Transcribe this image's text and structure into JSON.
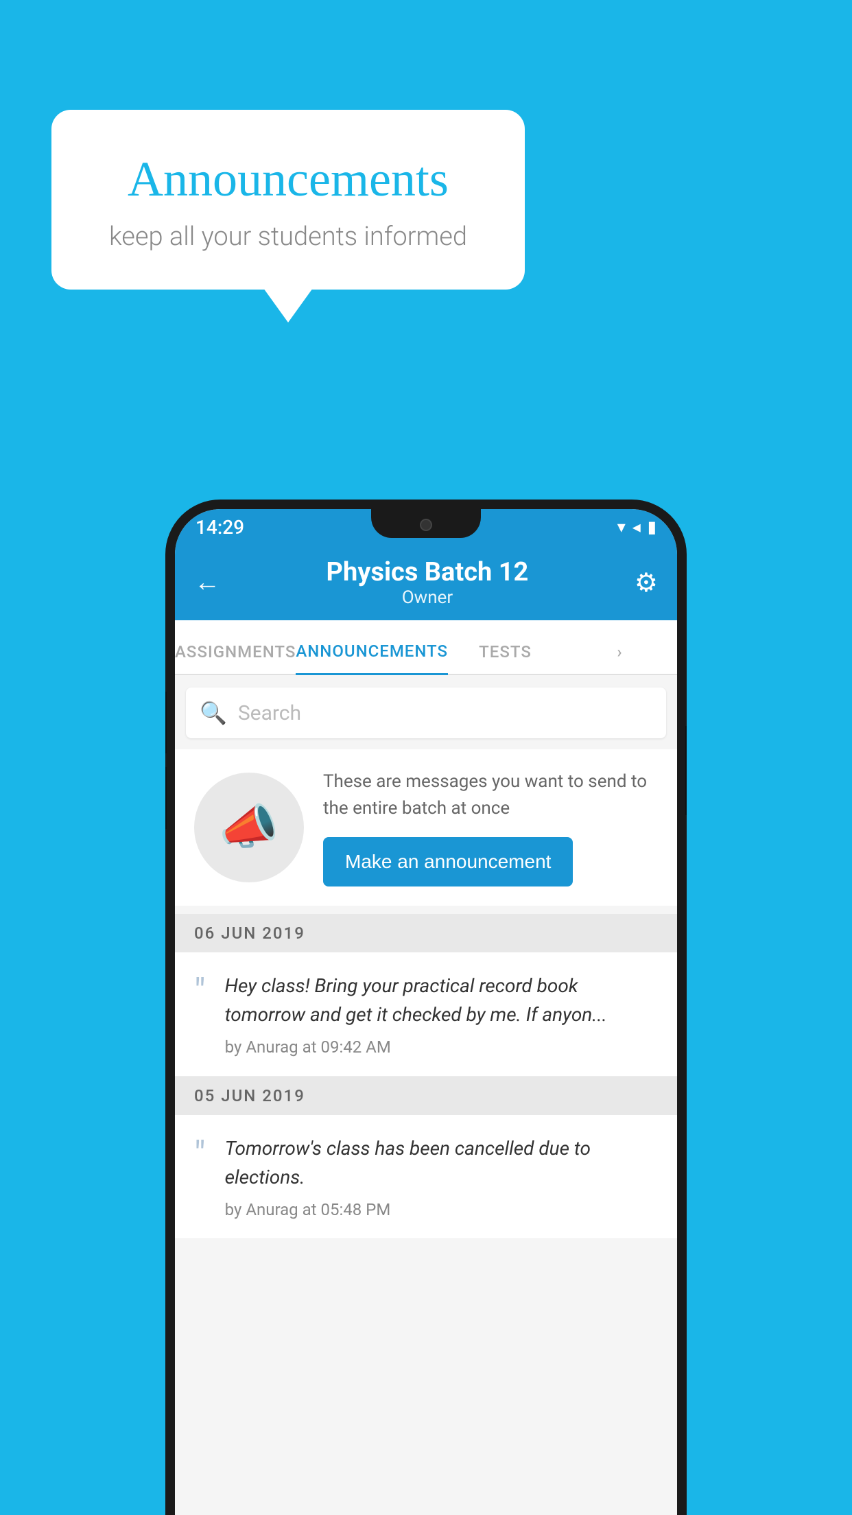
{
  "bubble": {
    "title": "Announcements",
    "subtitle": "keep all your students informed"
  },
  "status_bar": {
    "time": "14:29",
    "wifi": "▾",
    "signal": "▲",
    "battery": "▮"
  },
  "header": {
    "title": "Physics Batch 12",
    "subtitle": "Owner",
    "back_label": "←",
    "gear_label": "⚙"
  },
  "tabs": [
    {
      "label": "ASSIGNMENTS",
      "active": false
    },
    {
      "label": "ANNOUNCEMENTS",
      "active": true
    },
    {
      "label": "TESTS",
      "active": false
    },
    {
      "label": "›",
      "active": false
    }
  ],
  "search": {
    "placeholder": "Search"
  },
  "promo": {
    "description": "These are messages you want to send to the entire batch at once",
    "button_label": "Make an announcement"
  },
  "announcements": [
    {
      "date": "06  JUN  2019",
      "message": "Hey class! Bring your practical record book tomorrow and get it checked by me. If anyon...",
      "by": "by Anurag at 09:42 AM"
    },
    {
      "date": "05  JUN  2019",
      "message": "Tomorrow's class has been cancelled due to elections.",
      "by": "by Anurag at 05:48 PM"
    }
  ]
}
